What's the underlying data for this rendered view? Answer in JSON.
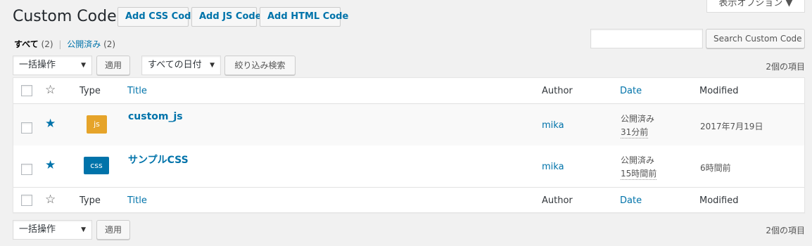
{
  "header": {
    "title": "Custom Code",
    "add_css": "Add CSS Code",
    "add_js": "Add JS Code",
    "add_html": "Add HTML Code",
    "screen_options": "表示オプション ▼"
  },
  "views": {
    "all_label": "すべて",
    "all_count": "(2)",
    "separator": "|",
    "published_label": "公開済み",
    "published_count": "(2)"
  },
  "search": {
    "value": "",
    "button": "Search Custom Code"
  },
  "top_nav": {
    "bulk_action": "一括操作",
    "apply": "適用",
    "date_filter": "すべての日付",
    "filter_button": "絞り込み検索",
    "items_count": "2個の項目"
  },
  "bottom_nav": {
    "bulk_action": "一括操作",
    "apply": "適用",
    "items_count": "2個の項目"
  },
  "columns": {
    "type": "Type",
    "title": "Title",
    "author": "Author",
    "date": "Date",
    "modified": "Modified"
  },
  "rows": [
    {
      "badge": "js",
      "badge_color": "#e6a42a",
      "title": "custom_js",
      "author": "mika",
      "status": "公開済み",
      "ago": "31分前",
      "modified": "2017年7月19日",
      "starred": true
    },
    {
      "badge": "css",
      "badge_color": "#0073aa",
      "title": "サンプルCSS",
      "author": "mika",
      "status": "公開済み",
      "ago": "15時間前",
      "modified": "6時間前",
      "starred": true
    }
  ],
  "icons": {
    "star_outline": "☆",
    "star_filled": "★",
    "caret": "▼"
  },
  "colors": {
    "link": "#0073aa",
    "background": "#f1f1f1"
  }
}
